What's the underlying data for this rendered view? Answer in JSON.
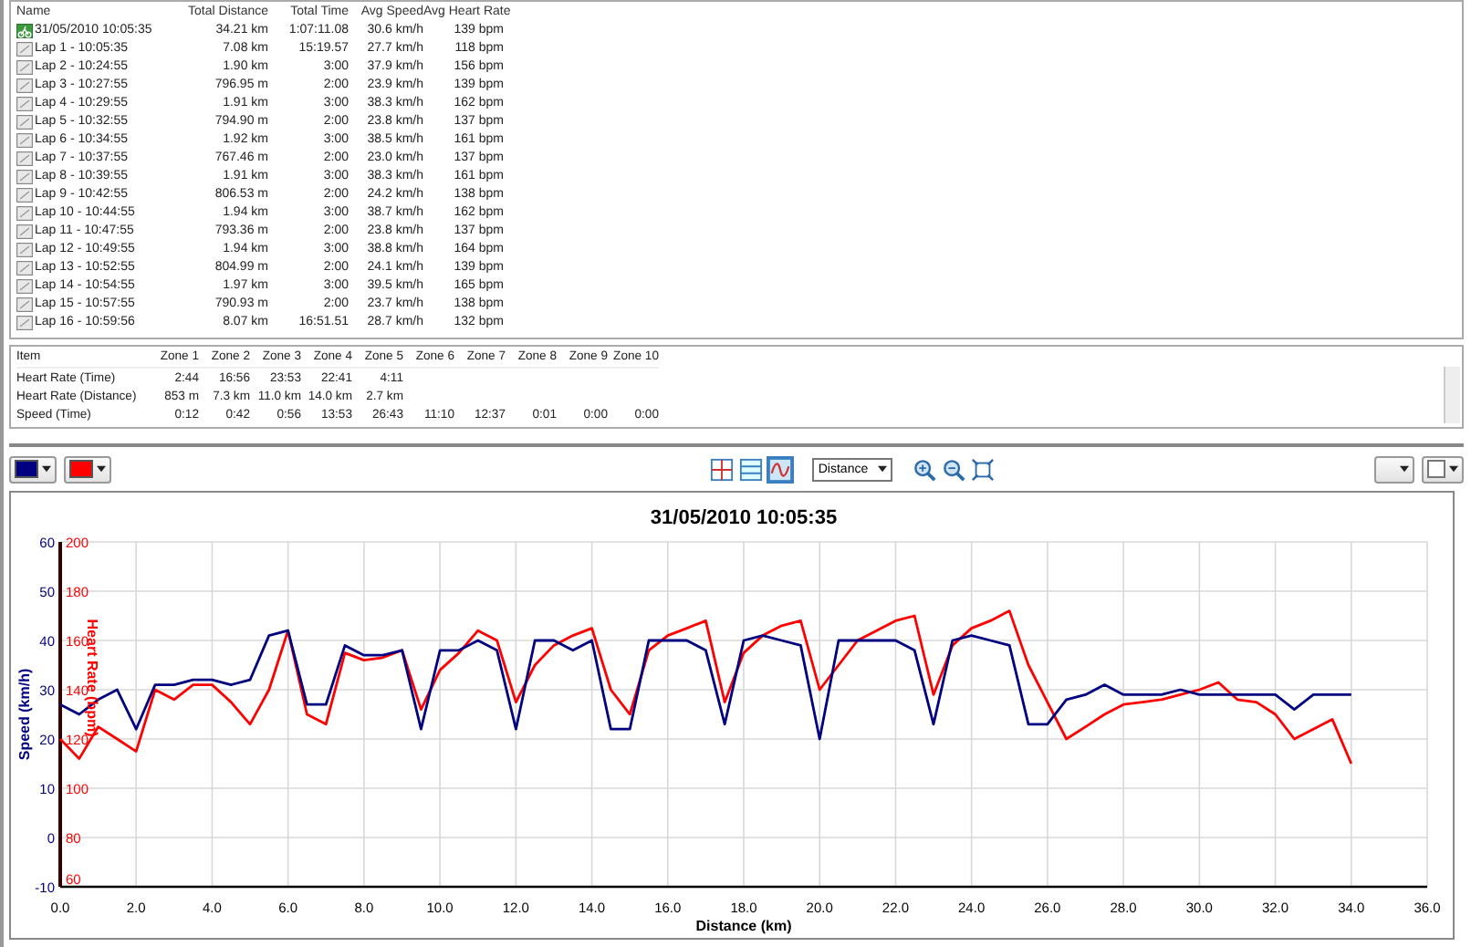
{
  "laps_table": {
    "columns": [
      "Name",
      "Total Distance",
      "Total Time",
      "Avg Speed",
      "Avg Heart Rate"
    ],
    "rows": [
      {
        "kind": "session",
        "cells": [
          "31/05/2010 10:05:35",
          "34.21 km",
          "1:07:11.08",
          "30.6 km/h",
          "139 bpm"
        ]
      },
      {
        "kind": "lap",
        "cells": [
          "Lap 1 - 10:05:35",
          "7.08 km",
          "15:19.57",
          "27.7 km/h",
          "118 bpm"
        ]
      },
      {
        "kind": "lap",
        "cells": [
          "Lap 2 - 10:24:55",
          "1.90 km",
          "3:00",
          "37.9 km/h",
          "156 bpm"
        ]
      },
      {
        "kind": "lap",
        "cells": [
          "Lap 3 - 10:27:55",
          "796.95 m",
          "2:00",
          "23.9 km/h",
          "139 bpm"
        ]
      },
      {
        "kind": "lap",
        "cells": [
          "Lap 4 - 10:29:55",
          "1.91 km",
          "3:00",
          "38.3 km/h",
          "162 bpm"
        ]
      },
      {
        "kind": "lap",
        "cells": [
          "Lap 5 - 10:32:55",
          "794.90 m",
          "2:00",
          "23.8 km/h",
          "137 bpm"
        ]
      },
      {
        "kind": "lap",
        "cells": [
          "Lap 6 - 10:34:55",
          "1.92 km",
          "3:00",
          "38.5 km/h",
          "161 bpm"
        ]
      },
      {
        "kind": "lap",
        "cells": [
          "Lap 7 - 10:37:55",
          "767.46 m",
          "2:00",
          "23.0 km/h",
          "137 bpm"
        ]
      },
      {
        "kind": "lap",
        "cells": [
          "Lap 8 - 10:39:55",
          "1.91 km",
          "3:00",
          "38.3 km/h",
          "161 bpm"
        ]
      },
      {
        "kind": "lap",
        "cells": [
          "Lap 9 - 10:42:55",
          "806.53 m",
          "2:00",
          "24.2 km/h",
          "138 bpm"
        ]
      },
      {
        "kind": "lap",
        "cells": [
          "Lap 10 - 10:44:55",
          "1.94 km",
          "3:00",
          "38.7 km/h",
          "162 bpm"
        ]
      },
      {
        "kind": "lap",
        "cells": [
          "Lap 11 - 10:47:55",
          "793.36 m",
          "2:00",
          "23.8 km/h",
          "137 bpm"
        ]
      },
      {
        "kind": "lap",
        "cells": [
          "Lap 12 - 10:49:55",
          "1.94 km",
          "3:00",
          "38.8 km/h",
          "164 bpm"
        ]
      },
      {
        "kind": "lap",
        "cells": [
          "Lap 13 - 10:52:55",
          "804.99 m",
          "2:00",
          "24.1 km/h",
          "139 bpm"
        ]
      },
      {
        "kind": "lap",
        "cells": [
          "Lap 14 - 10:54:55",
          "1.97 km",
          "3:00",
          "39.5 km/h",
          "165 bpm"
        ]
      },
      {
        "kind": "lap",
        "cells": [
          "Lap 15 - 10:57:55",
          "790.93 m",
          "2:00",
          "23.7 km/h",
          "138 bpm"
        ]
      },
      {
        "kind": "lap",
        "cells": [
          "Lap 16 - 10:59:56",
          "8.07 km",
          "16:51.51",
          "28.7 km/h",
          "132 bpm"
        ]
      }
    ]
  },
  "zones_table": {
    "columns": [
      "Item",
      "Zone 1",
      "Zone 2",
      "Zone 3",
      "Zone 4",
      "Zone 5",
      "Zone 6",
      "Zone 7",
      "Zone 8",
      "Zone 9",
      "Zone 10"
    ],
    "rows": [
      [
        "Heart Rate (Time)",
        "2:44",
        "16:56",
        "23:53",
        "22:41",
        "4:11"
      ],
      [
        "Heart Rate (Distance)",
        "853 m",
        "7.3 km",
        "11.0 km",
        "14.0 km",
        "2.7 km"
      ],
      [
        "Speed (Time)",
        "0:12",
        "0:42",
        "0:56",
        "13:53",
        "26:43",
        "11:10",
        "12:37",
        "0:01",
        "0:00",
        "0:00"
      ]
    ]
  },
  "toolbar": {
    "x_axis_select": "Distance"
  },
  "chart": {
    "chart_data": {
      "type": "line",
      "title": "31/05/2010 10:05:35",
      "xlabel": "Distance (km)",
      "grid": true,
      "x": [
        0,
        0.5,
        1,
        1.5,
        2,
        2.5,
        3,
        3.5,
        4,
        4.5,
        5,
        5.5,
        6,
        6.5,
        7,
        7.5,
        8,
        8.5,
        9,
        9.5,
        10,
        10.5,
        11,
        11.5,
        12,
        12.5,
        13,
        13.5,
        14,
        14.5,
        15,
        15.5,
        16,
        16.5,
        17,
        17.5,
        18,
        18.5,
        19,
        19.5,
        20,
        20.5,
        21,
        21.5,
        22,
        22.5,
        23,
        23.5,
        24,
        24.5,
        25,
        25.5,
        26,
        26.5,
        27,
        27.5,
        28,
        28.5,
        29,
        29.5,
        30,
        30.5,
        31,
        31.5,
        32,
        32.5,
        33,
        33.5,
        34
      ],
      "series": [
        {
          "name": "Speed (km/h)",
          "color": "#000080",
          "axis": "y",
          "values": [
            27,
            25,
            28,
            30,
            22,
            31,
            31,
            32,
            32,
            31,
            32,
            41,
            42,
            27,
            27,
            39,
            37,
            37,
            38,
            22,
            38,
            38,
            40,
            38,
            22,
            40,
            40,
            38,
            40,
            22,
            22,
            40,
            40,
            40,
            38,
            23,
            40,
            41,
            40,
            39,
            20,
            40,
            40,
            40,
            40,
            38,
            23,
            40,
            41,
            40,
            39,
            23,
            23,
            28,
            29,
            31,
            29,
            29,
            29,
            30,
            29,
            29,
            29,
            29,
            29,
            26,
            29,
            29,
            29
          ]
        },
        {
          "name": "Heart Rate (bpm)",
          "color": "#ff0000",
          "axis": "y2",
          "values": [
            120,
            112,
            125,
            120,
            115,
            140,
            136,
            142,
            142,
            135,
            126,
            140,
            164,
            130,
            126,
            155,
            152,
            153,
            156,
            132,
            148,
            155,
            164,
            160,
            135,
            150,
            158,
            162,
            165,
            140,
            130,
            156,
            162,
            165,
            168,
            135,
            155,
            162,
            166,
            168,
            140,
            150,
            160,
            164,
            168,
            170,
            138,
            158,
            165,
            168,
            172,
            150,
            135,
            120,
            125,
            130,
            134,
            135,
            136,
            138,
            140,
            143,
            136,
            135,
            130,
            120,
            124,
            128,
            110
          ]
        }
      ],
      "xlim": [
        0,
        36
      ],
      "ylim": [
        -10,
        60
      ],
      "y2lim": [
        60,
        200
      ],
      "xticks": [
        {
          "value": 0,
          "label": "0.0"
        },
        {
          "value": 2,
          "label": "2.0"
        },
        {
          "value": 4,
          "label": "4.0"
        },
        {
          "value": 6,
          "label": "6.0"
        },
        {
          "value": 8,
          "label": "8.0"
        },
        {
          "value": 10,
          "label": "10.0"
        },
        {
          "value": 12,
          "label": "12.0"
        },
        {
          "value": 14,
          "label": "14.0"
        },
        {
          "value": 16,
          "label": "16.0"
        },
        {
          "value": 18,
          "label": "18.0"
        },
        {
          "value": 20,
          "label": "20.0"
        },
        {
          "value": 22,
          "label": "22.0"
        },
        {
          "value": 24,
          "label": "24.0"
        },
        {
          "value": 26,
          "label": "26.0"
        },
        {
          "value": 28,
          "label": "28.0"
        },
        {
          "value": 30,
          "label": "30.0"
        },
        {
          "value": 32,
          "label": "32.0"
        },
        {
          "value": 34,
          "label": "34.0"
        },
        {
          "value": 36,
          "label": "36.0"
        }
      ],
      "yticks": [
        -10,
        0,
        10,
        20,
        30,
        40,
        50,
        60
      ],
      "y2ticks": [
        60,
        80,
        100,
        120,
        140,
        160,
        180,
        200
      ]
    }
  }
}
